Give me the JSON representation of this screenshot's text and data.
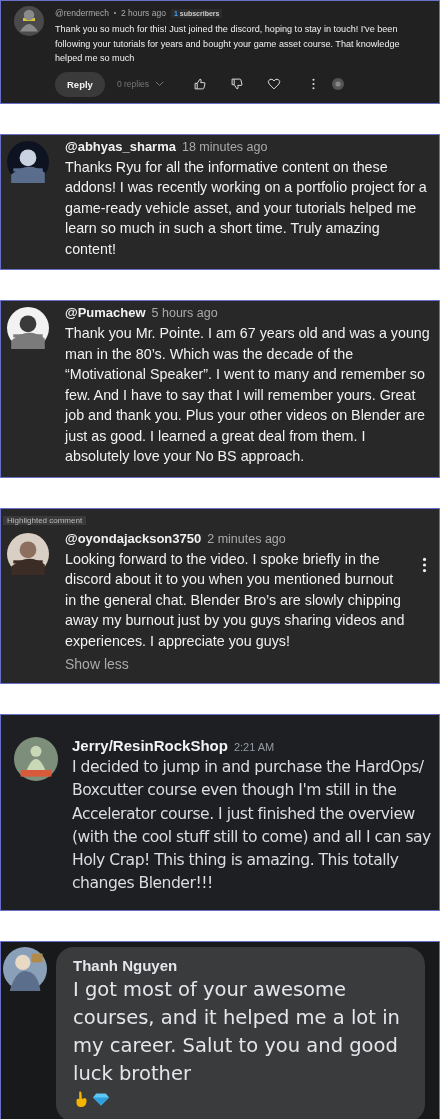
{
  "comments": [
    {
      "kind": "youtube-compact",
      "author": "@rendermech",
      "time": "2 hours ago",
      "badge_count": "1",
      "badge_label": "subscribers",
      "text": "Thank you so much for this! Just joined the discord, hoping to stay in touch! I've been following your tutorials for years and bought your game asset course. That knowledge helped me so much",
      "reply": "Reply",
      "replies": "0 replies"
    },
    {
      "kind": "youtube",
      "author": "@abhyas_sharma",
      "time": "18 minutes ago",
      "text": "Thanks Ryu for all the informative content on these addons! I was recently working on a portfolio project for a game-ready vehicle asset, and your tutorials helped me learn so much in such a short time. Truly amazing content!",
      "menu": false
    },
    {
      "kind": "youtube",
      "author": "@Pumachew",
      "time": "5 hours ago",
      "text": "Thank you Mr. Pointe. I am 67 years old and was a young man in the 80’s. Which was the decade of the “Motivational Speaker”. I went to many and remember so few. And I have to say that I will remember yours. Great job and thank you. Plus your other videos on Blender are just as good. I learned a great deal from them. I absolutely love your No BS approach.",
      "menu": false
    },
    {
      "kind": "youtube",
      "label": "Highlighted comment",
      "author": "@oyondajackson3750",
      "time": "2 minutes ago",
      "text": "Looking forward to the video. I spoke briefly in the discord about it to you when you mentioned burnout in the general chat. Blender Bro’s are slowly chipping away my burnout just by you guys sharing videos and experiences. I appreciate you guys!",
      "show_less": "Show less",
      "menu": true
    },
    {
      "kind": "discord",
      "author": "Jerry/ResinRockShop",
      "time": "2:21 AM",
      "text": "I decided to jump in and purchase the HardOps/ Boxcutter course even though I'm still in the Accelerator course.  I just finished the overview (with the cool stuff still to come) and all I can say Holy Crap!  This thing is amazing.  This totally changes Blender!!!"
    },
    {
      "kind": "facebook",
      "author": "Thanh Nguyen",
      "text": "I got most of your awesome courses, and it helped me a lot in my career. Salut to you and good luck brother"
    }
  ]
}
